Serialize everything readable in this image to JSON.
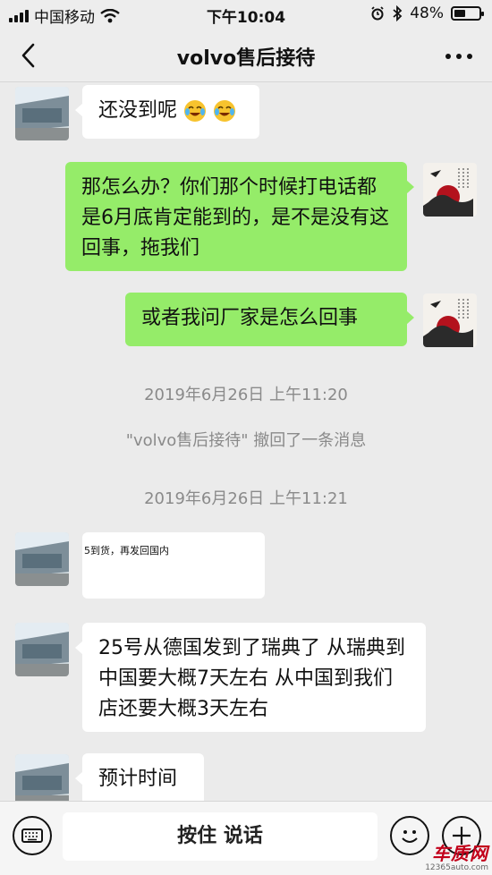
{
  "status_bar": {
    "carrier": "中国移动",
    "time": "下午10:04",
    "battery_percent": "48%",
    "battery_level": 0.48
  },
  "nav": {
    "title": "volvo售后接待"
  },
  "messages": {
    "m1_text": "还没到呢",
    "m2_text": "那怎么办？你们那个时候打电话都是6月底肯定能到的，是不是没有这回事，拖我们",
    "m3_text": "或者我问厂家是怎么回事",
    "ts1": "2019年6月26日 上午11:20",
    "system1": "\"volvo售后接待\" 撤回了一条消息",
    "ts2": "2019年6月26日 上午11:21",
    "image_snippet_text": "5到货，再发回国内",
    "m5_text": "25号从德国发到了瑞典了 从瑞典到中国要大概7天左右 从中国到我们店还要大概3天左右",
    "m6_text": "预计时间"
  },
  "input_bar": {
    "hold_to_talk": "按住 说话"
  },
  "watermark": {
    "main": "车质网",
    "sub": "12365auto.com"
  },
  "colors": {
    "my_bubble": "#95ec69",
    "their_bubble": "#ffffff",
    "chat_bg": "#ebebeb"
  },
  "icons": [
    "back-chevron-icon",
    "more-dots-icon",
    "wifi-icon",
    "alarm-icon",
    "bluetooth-icon",
    "keyboard-icon",
    "emoji-face-icon",
    "plus-icon",
    "crying-laughing-emoji-icon"
  ]
}
